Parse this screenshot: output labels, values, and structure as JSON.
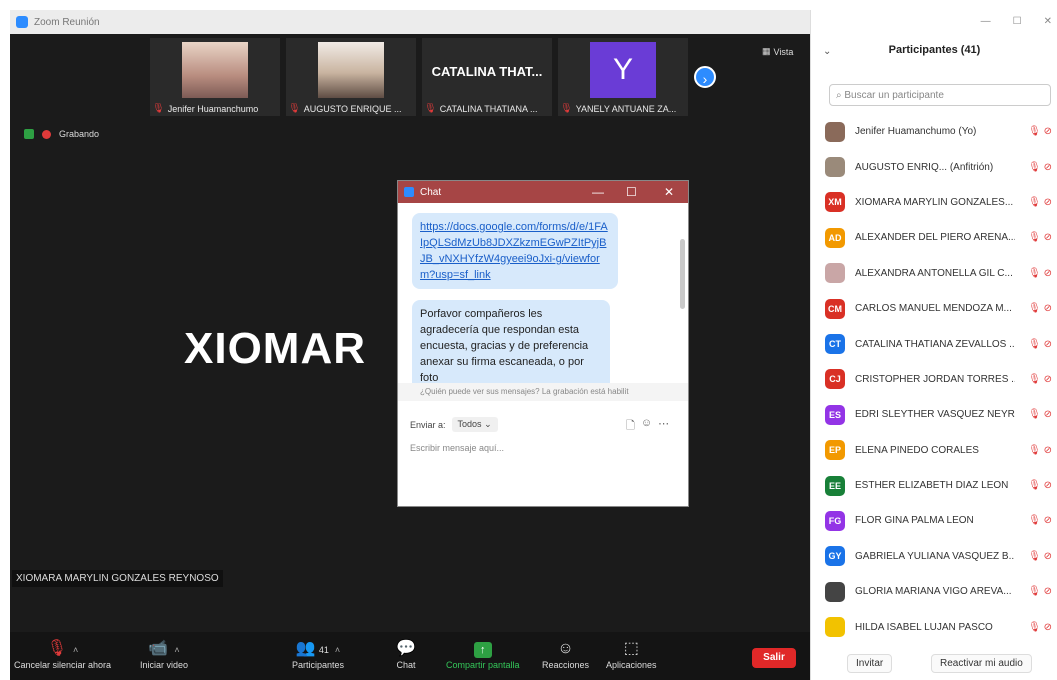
{
  "window": {
    "title": "Zoom Reunión"
  },
  "thumbnails": [
    {
      "name": "Jenifer Huamanchumo",
      "kind": "photo"
    },
    {
      "name": "AUGUSTO ENRIQUE ...",
      "kind": "photo"
    },
    {
      "name": "CATALINA THATIANA ...",
      "kind": "text",
      "big": "CATALINA THAT..."
    },
    {
      "name": "YANELY ANTUANE ZA...",
      "kind": "avatar",
      "letter": "Y"
    }
  ],
  "view_label": "Vista",
  "recording_label": "Grabando",
  "active_speaker": {
    "big": "XIOMAR",
    "label": "XIOMARA MARYLIN GONZALES REYNOSO"
  },
  "toolbar": {
    "mute": "Cancelar silenciar ahora",
    "video": "Iniciar video",
    "participants": "Participantes",
    "participants_count": "41",
    "chat": "Chat",
    "share": "Compartir pantalla",
    "reactions": "Reacciones",
    "apps": "Aplicaciones",
    "leave": "Salir"
  },
  "chat": {
    "title": "Chat",
    "link": "https://docs.google.com/forms/d/e/1FAIpQLSdMzUb8JDXZkzmEGwPZItPyjBJB_vNXHYfzW4gyeei9oJxi-g/viewform?usp=sf_link",
    "message": "Porfavor compañeros les agradecería que respondan esta encuesta, gracias y de preferencia anexar su firma escaneada, o por foto",
    "notice": "¿Quién puede ver sus mensajes? La grabación está habilit",
    "send_to_label": "Enviar a:",
    "send_to_value": "Todos",
    "placeholder": "Escribir mensaje aquí..."
  },
  "participants_panel": {
    "title": "Participantes (41)",
    "search_placeholder": "Buscar un participante",
    "invite": "Invitar",
    "reactivate_audio": "Reactivar mi audio",
    "list": [
      {
        "name": "Jenifer Huamanchumo (Yo)",
        "initials": "",
        "color": "#8a6a5a"
      },
      {
        "name": "AUGUSTO ENRIQ... (Anfitrión)",
        "initials": "",
        "color": "#9a8a7a"
      },
      {
        "name": "XIOMARA MARYLIN GONZALES...",
        "initials": "XM",
        "color": "#d93025"
      },
      {
        "name": "ALEXANDER DEL PIERO ARENA...",
        "initials": "AD",
        "color": "#f29900"
      },
      {
        "name": "ALEXANDRA ANTONELLA GIL C...",
        "initials": "",
        "color": "#c9a6a6"
      },
      {
        "name": "CARLOS MANUEL MENDOZA M...",
        "initials": "CM",
        "color": "#d93025"
      },
      {
        "name": "CATALINA THATIANA ZEVALLOS ...",
        "initials": "CT",
        "color": "#1a73e8"
      },
      {
        "name": "CRISTOPHER JORDAN TORRES ...",
        "initials": "CJ",
        "color": "#d93025"
      },
      {
        "name": "EDRI SLEYTHER VASQUEZ NEYRA",
        "initials": "ES",
        "color": "#9334e6"
      },
      {
        "name": "ELENA PINEDO CORALES",
        "initials": "EP",
        "color": "#f29900"
      },
      {
        "name": "ESTHER ELIZABETH DIAZ LEON",
        "initials": "EE",
        "color": "#188038"
      },
      {
        "name": "FLOR GINA PALMA LEON",
        "initials": "FG",
        "color": "#9334e6"
      },
      {
        "name": "GABRIELA YULIANA VASQUEZ B...",
        "initials": "GY",
        "color": "#1a73e8"
      },
      {
        "name": "GLORIA MARIANA VIGO AREVA...",
        "initials": "",
        "color": "#444444"
      },
      {
        "name": "HILDA ISABEL LUJAN PASCO",
        "initials": "",
        "color": "#f2c200"
      }
    ]
  }
}
